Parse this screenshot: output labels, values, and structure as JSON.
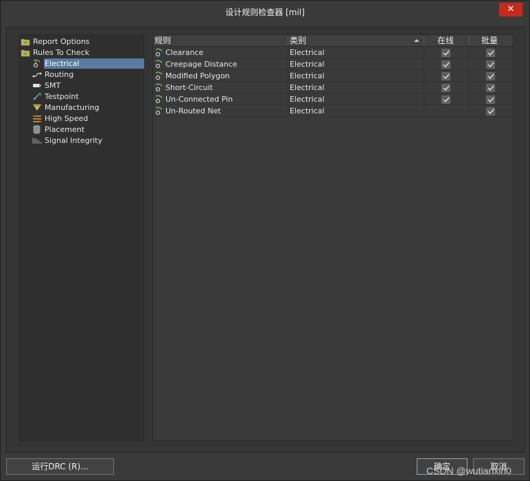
{
  "window": {
    "title": "设计规则检查器 [mil]",
    "close_label": "✕"
  },
  "tree": {
    "report_options": "Report Options",
    "rules_to_check": "Rules To Check",
    "categories": [
      {
        "label": "Electrical",
        "icon": "electrical-icon",
        "selected": true
      },
      {
        "label": "Routing",
        "icon": "routing-icon"
      },
      {
        "label": "SMT",
        "icon": "smt-icon"
      },
      {
        "label": "Testpoint",
        "icon": "testpoint-icon"
      },
      {
        "label": "Manufacturing",
        "icon": "manufacturing-icon"
      },
      {
        "label": "High Speed",
        "icon": "high-speed-icon"
      },
      {
        "label": "Placement",
        "icon": "placement-icon"
      },
      {
        "label": "Signal Integrity",
        "icon": "signal-integrity-icon"
      }
    ]
  },
  "table": {
    "columns": {
      "rule": "规则",
      "category": "类别",
      "online": "在线",
      "batch": "批量"
    },
    "rows": [
      {
        "rule": "Clearance",
        "category": "Electrical",
        "online": true,
        "batch": true
      },
      {
        "rule": "Creepage Distance",
        "category": "Electrical",
        "online": true,
        "batch": true
      },
      {
        "rule": "Modified Polygon",
        "category": "Electrical",
        "online": true,
        "batch": true
      },
      {
        "rule": "Short-Circuit",
        "category": "Electrical",
        "online": true,
        "batch": true
      },
      {
        "rule": "Un-Connected Pin",
        "category": "Electrical",
        "online": true,
        "batch": true
      },
      {
        "rule": "Un-Routed Net",
        "category": "Electrical",
        "online": false,
        "batch": true
      }
    ]
  },
  "buttons": {
    "run_drc": "运行DRC (R)...",
    "ok": "确定",
    "cancel": "取消"
  },
  "watermark": "CSDN @wutianxin0",
  "colors": {
    "accent_selected": "#5a7aa0",
    "close_red": "#c42b1c",
    "background": "#3a3a3a"
  }
}
